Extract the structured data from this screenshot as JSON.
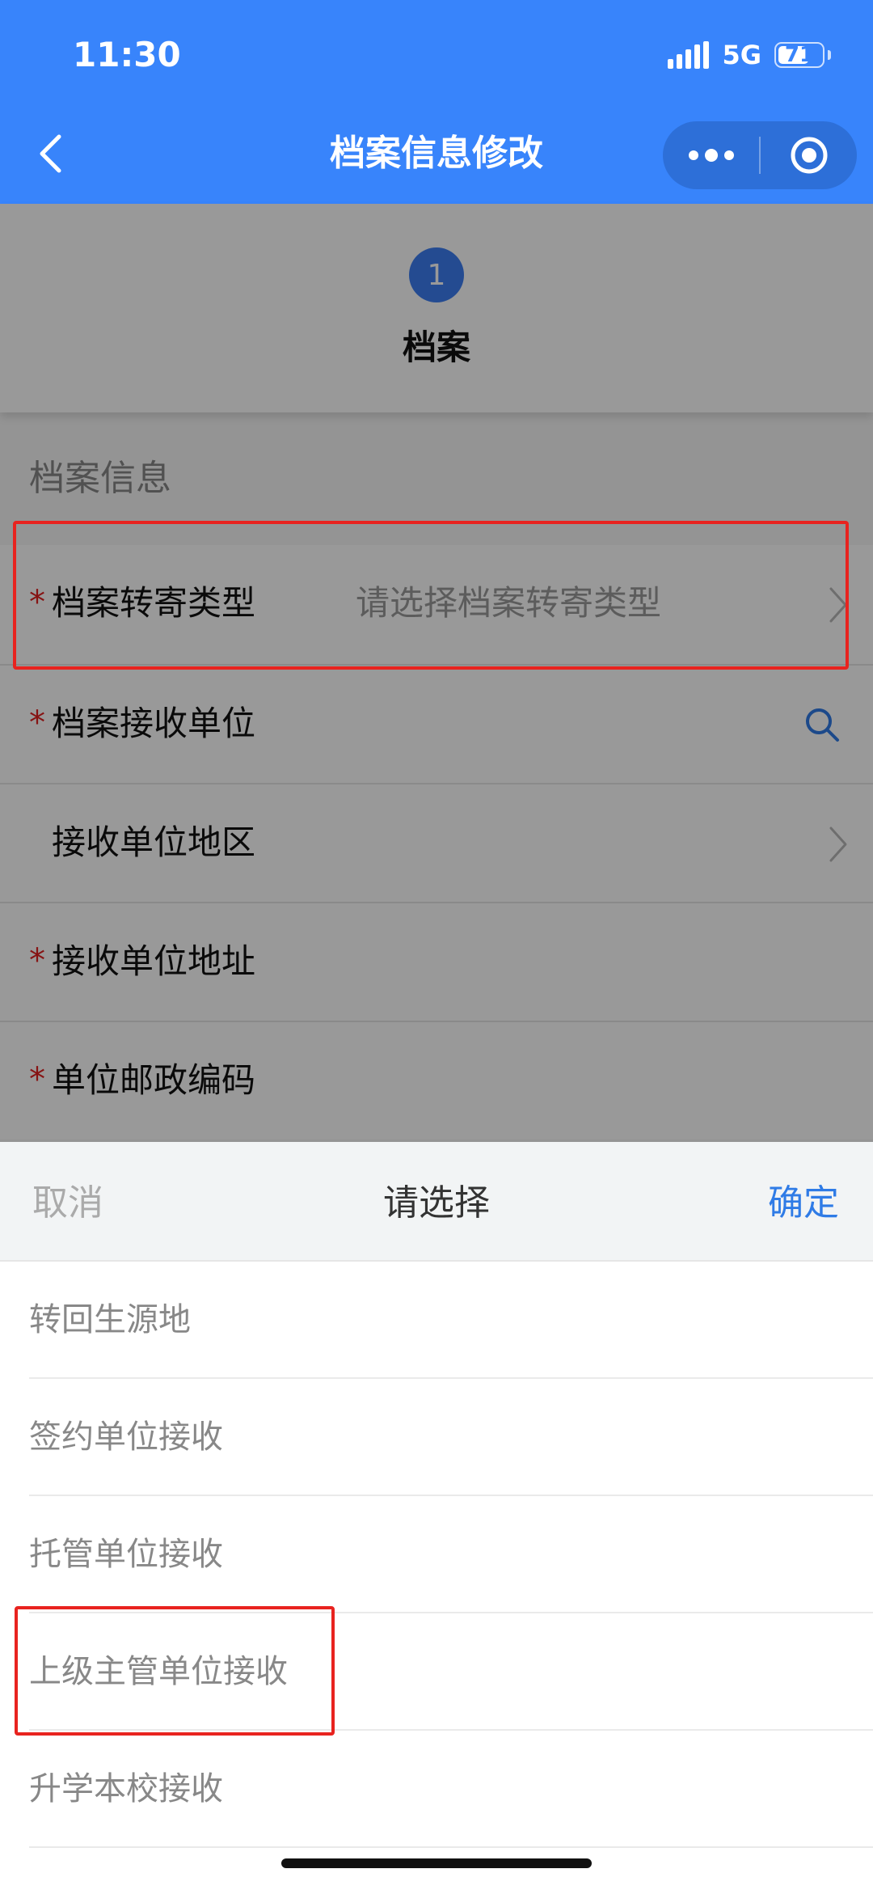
{
  "status_bar": {
    "time": "11:30",
    "network": "5G",
    "battery": "71",
    "battery_level": 0.71
  },
  "nav": {
    "title": "档案信息修改",
    "back_icon": "chevron-left-icon",
    "more_icon": "more-dots-icon",
    "close_icon": "target-circle-icon"
  },
  "steps": {
    "number": "1",
    "label": "档案"
  },
  "section_title": "档案信息",
  "form": {
    "rows": [
      {
        "required": "*",
        "label": "档案转寄类型",
        "placeholder": "请选择档案转寄类型",
        "accessory": "chevron-right-icon"
      },
      {
        "required": "*",
        "label": "档案接收单位",
        "placeholder": "",
        "accessory": "search-icon"
      },
      {
        "required": "",
        "label": "接收单位地区",
        "placeholder": "",
        "accessory": "chevron-right-icon"
      },
      {
        "required": "*",
        "label": "接收单位地址",
        "placeholder": "",
        "accessory": ""
      },
      {
        "required": "*",
        "label": "单位邮政编码",
        "placeholder": "",
        "accessory": ""
      }
    ]
  },
  "picker": {
    "cancel_label": "取消",
    "title": "请选择",
    "confirm_label": "确定",
    "options": [
      "转回生源地",
      "签约单位接收",
      "托管单位接收",
      "上级主管单位接收",
      "升学本校接收"
    ]
  },
  "colors": {
    "header_bg": "#3884fb",
    "required_star": "#e02020",
    "highlight_box": "#e8231f",
    "confirm_text": "#2f7be6",
    "step_circle": "#3d7ef2"
  }
}
